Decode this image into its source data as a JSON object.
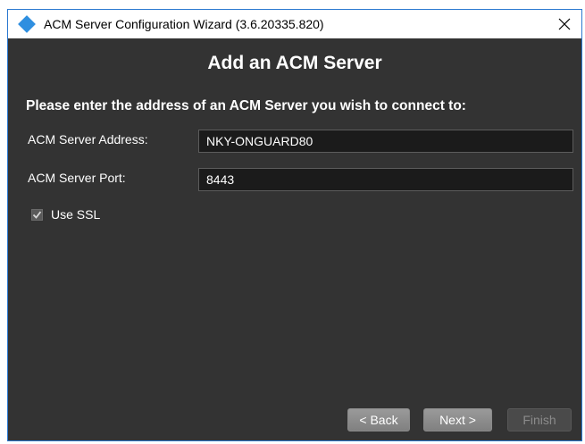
{
  "window": {
    "title": "ACM Server Configuration Wizard (3.6.20335.820)"
  },
  "page": {
    "heading": "Add an ACM Server",
    "instruction": "Please enter the address of an ACM Server you wish to connect to:"
  },
  "form": {
    "address_label": "ACM Server Address:",
    "address_value": "NKY-ONGUARD80",
    "port_label": "ACM Server Port:",
    "port_value": "8443",
    "ssl_label": "Use SSL",
    "ssl_checked": true
  },
  "buttons": {
    "back": "< Back",
    "next": "Next >",
    "finish": "Finish"
  },
  "colors": {
    "background": "#333333",
    "accent": "#2f8fe0"
  }
}
